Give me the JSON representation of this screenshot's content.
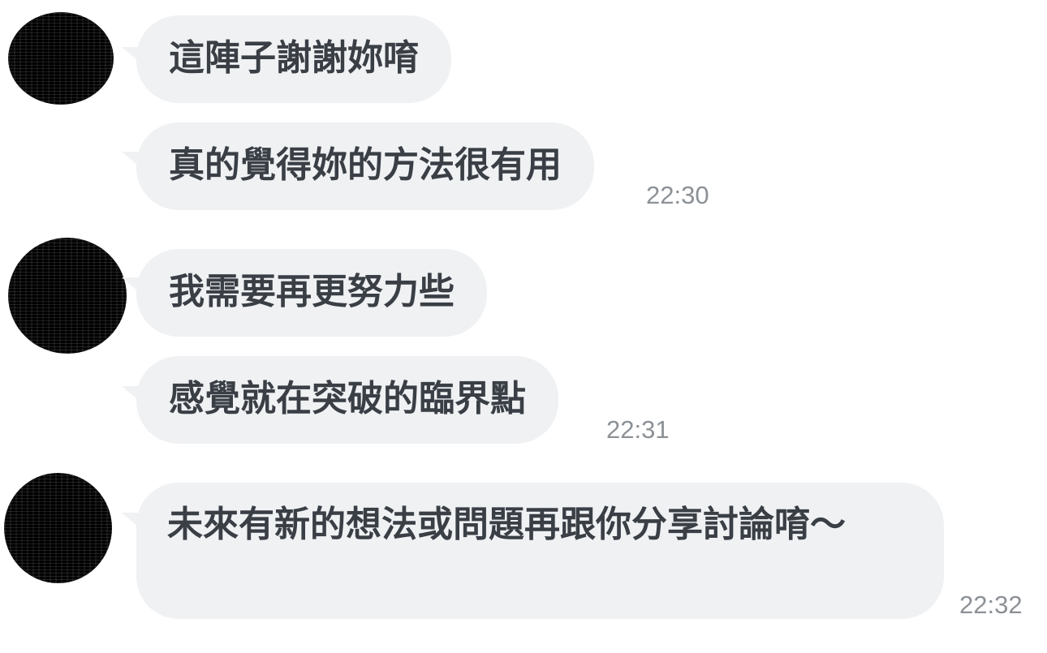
{
  "messages": [
    {
      "text": "這陣子謝謝妳唷",
      "time": ""
    },
    {
      "text": "真的覺得妳的方法很有用",
      "time": "22:30"
    },
    {
      "text": "我需要再更努力些",
      "time": ""
    },
    {
      "text": "感覺就在突破的臨界點",
      "time": "22:31"
    },
    {
      "text": "未來有新的想法或問題再跟你分享討論唷～",
      "time": "22:32"
    }
  ]
}
